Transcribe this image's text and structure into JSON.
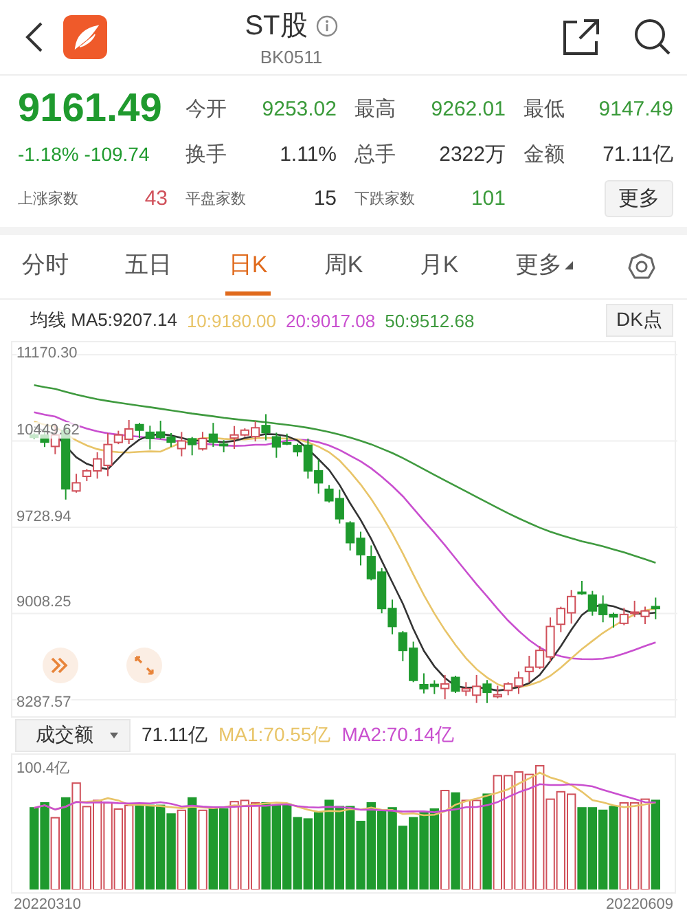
{
  "header": {
    "title": "ST股",
    "code": "BK0511"
  },
  "quote": {
    "price": "9161.49",
    "change_pct": "-1.18%",
    "change": "-109.74",
    "color": "#1f9a2e",
    "stats": [
      {
        "label": "今开",
        "value": "9253.02",
        "color": "#3a9a3a"
      },
      {
        "label": "最高",
        "value": "9262.01",
        "color": "#3a9a3a"
      },
      {
        "label": "最低",
        "value": "9147.49",
        "color": "#3a9a3a"
      },
      {
        "label": "换手",
        "value": "1.11%",
        "color": "#333333"
      },
      {
        "label": "总手",
        "value": "2322万",
        "color": "#333333"
      },
      {
        "label": "金额",
        "value": "71.11亿",
        "color": "#333333"
      }
    ],
    "breadth": [
      {
        "label": "上涨家数",
        "value": "43",
        "color": "#d0505a"
      },
      {
        "label": "平盘家数",
        "value": "15",
        "color": "#333333"
      },
      {
        "label": "下跌家数",
        "value": "101",
        "color": "#3a9a3a"
      }
    ],
    "more_button": "更多"
  },
  "tabs": [
    {
      "label": "分时",
      "selected": false,
      "menu": false
    },
    {
      "label": "五日",
      "selected": false,
      "menu": false
    },
    {
      "label": "日K",
      "selected": true,
      "menu": false
    },
    {
      "label": "周K",
      "selected": false,
      "menu": false
    },
    {
      "label": "月K",
      "selected": false,
      "menu": false
    },
    {
      "label": "更多",
      "selected": false,
      "menu": true
    }
  ],
  "ma_legend": {
    "label": "均线",
    "items": [
      {
        "text": "MA5:9207.14",
        "color": "#333333"
      },
      {
        "text": "10:9180.00",
        "color": "#e8c468"
      },
      {
        "text": "20:9017.08",
        "color": "#c94fcf"
      },
      {
        "text": "50:9512.68",
        "color": "#3f9a3f"
      }
    ],
    "dk_button": "DK点"
  },
  "price_axis": [
    "11170.30",
    "10449.62",
    "9728.94",
    "9008.25",
    "8287.57"
  ],
  "volume": {
    "selector": "成交额",
    "value": "71.11亿",
    "mas": [
      {
        "text": "MA1:70.55亿",
        "color": "#e8c468"
      },
      {
        "text": "MA2:70.14亿",
        "color": "#c94fcf"
      }
    ],
    "axis_top": "100.4亿",
    "dates": [
      "20220310",
      "20220609"
    ]
  }
}
